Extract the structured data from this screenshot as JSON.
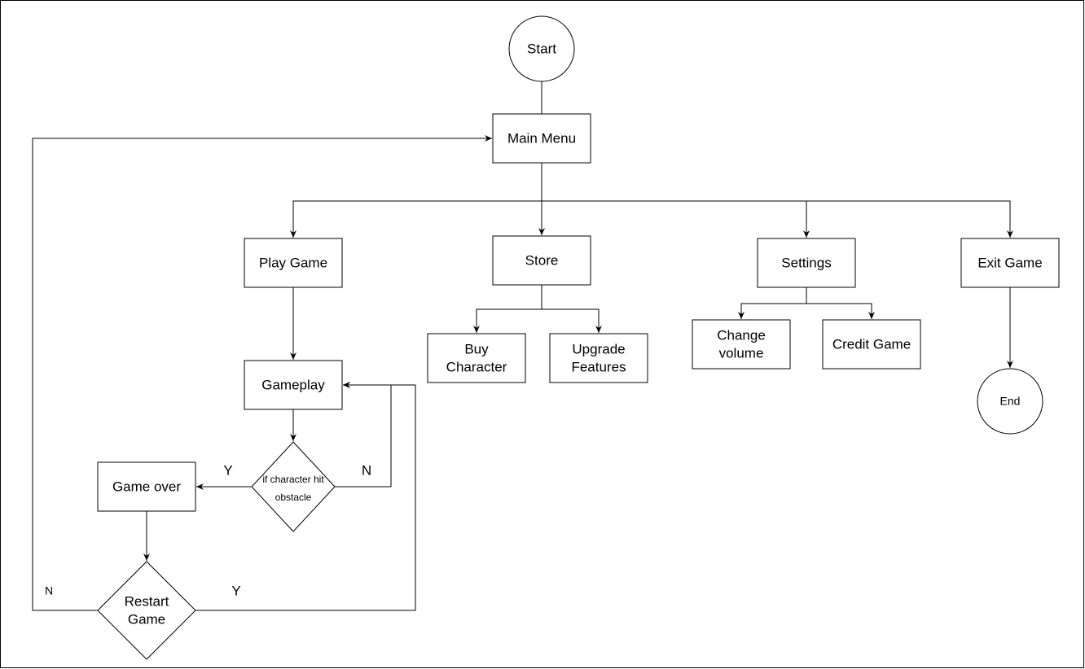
{
  "nodes": {
    "start": "Start",
    "main_menu": "Main Menu",
    "play_game": "Play Game",
    "store": "Store",
    "settings": "Settings",
    "exit_game": "Exit Game",
    "buy_character": [
      "Buy",
      "Character"
    ],
    "upgrade_features": [
      "Upgrade",
      "Features"
    ],
    "change_volume": [
      "Change",
      "volume"
    ],
    "credit_game": "Credit Game",
    "end": "End",
    "gameplay": "Gameplay",
    "hit_obstacle": [
      "if character hit",
      "obstacle"
    ],
    "game_over": "Game over",
    "restart_game": [
      "Restart",
      "Game"
    ]
  },
  "edge_labels": {
    "hit_yes": "Y",
    "hit_no": "N",
    "restart_no": "N",
    "restart_yes": "Y"
  }
}
